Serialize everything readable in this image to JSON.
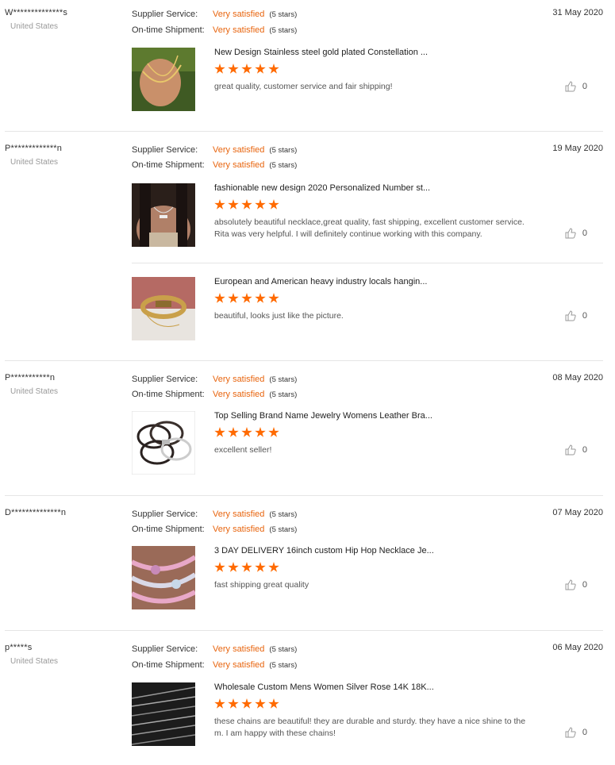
{
  "labels": {
    "supplier_service": "Supplier Service:",
    "on_time_shipment": "On-time Shipment:",
    "very_satisfied": "Very satisfied",
    "five_stars": "(5 stars)"
  },
  "reviews": [
    {
      "user": "W**************s",
      "country": "United States",
      "date": "31 May 2020",
      "items": [
        {
          "title": "New Design Stainless steel gold plated Constellation ...",
          "stars": 5,
          "comment": "great quality, customer service and fair shipping!",
          "likes": "0",
          "thumb_icon": "gold-necklace-hand-image"
        }
      ]
    },
    {
      "user": "P*************n",
      "country": "United States",
      "date": "19 May 2020",
      "items": [
        {
          "title": "fashionable new design 2020 Personalized Number st...",
          "stars": 5,
          "comment": "absolutely beautiful necklace,great quality, fast shipping, excellent customer service. Rita was very helpful. I will definitely continue working with this company.",
          "likes": "0",
          "thumb_icon": "number-necklace-image"
        },
        {
          "title": "European and American heavy industry locals hangin...",
          "stars": 5,
          "comment": "beautiful, looks just like the picture.",
          "likes": "0",
          "thumb_icon": "gold-bangle-image"
        }
      ]
    },
    {
      "user": "P***********n",
      "country": "United States",
      "date": "08 May 2020",
      "items": [
        {
          "title": "Top Selling Brand Name Jewelry Womens Leather Bra...",
          "stars": 5,
          "comment": "excellent seller!",
          "likes": "0",
          "thumb_icon": "leather-bracelets-image"
        }
      ]
    },
    {
      "user": "D**************n",
      "country": "",
      "date": "07 May 2020",
      "items": [
        {
          "title": "3 DAY DELIVERY 16inch custom Hip Hop Necklace Je...",
          "stars": 5,
          "comment": "fast shipping great quality",
          "likes": "0",
          "thumb_icon": "butterfly-chain-image"
        }
      ]
    },
    {
      "user": "p*****s",
      "country": "United States",
      "date": "06 May 2020",
      "items": [
        {
          "title": "Wholesale Custom Mens Women Silver Rose 14K 18K...",
          "stars": 5,
          "comment": "these chains are beautiful! they are durable and sturdy. they have a nice shine to them. I am happy with these chains!",
          "likes": "0",
          "thumb_icon": "silver-chains-image"
        }
      ]
    }
  ],
  "colors": {
    "accent": "#ff6a00",
    "satisfied_text": "#e8650f"
  }
}
